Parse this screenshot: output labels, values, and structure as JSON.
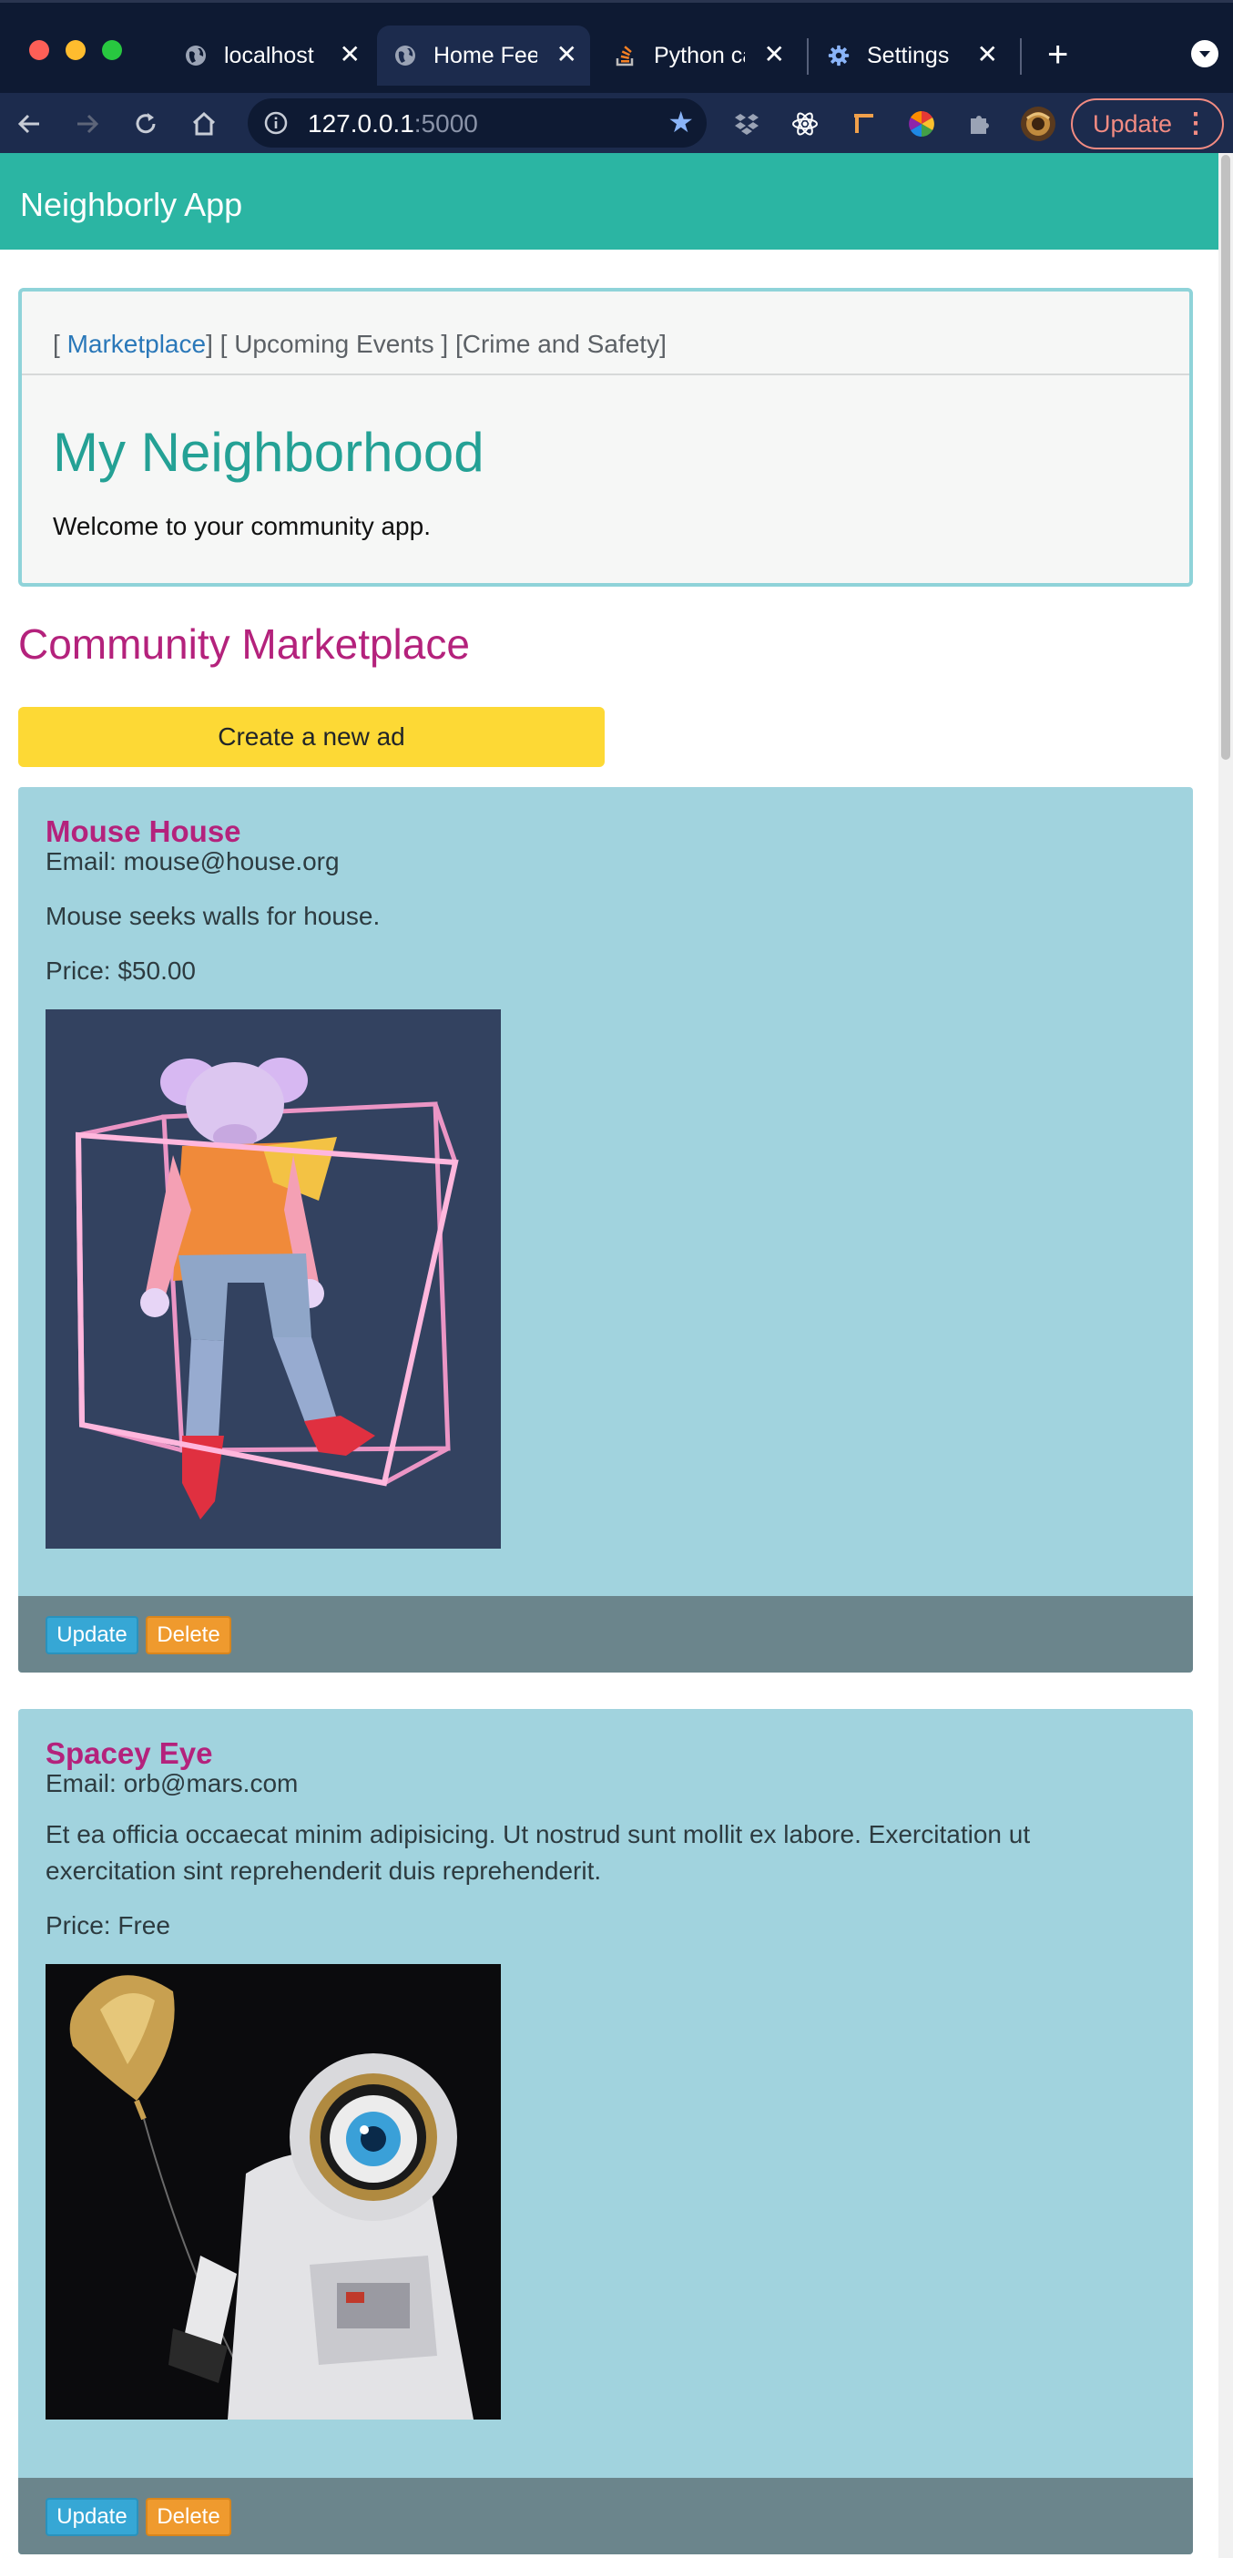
{
  "browser": {
    "tabs": [
      {
        "title": "localhost",
        "icon": "globe-icon",
        "active": false
      },
      {
        "title": "Home Feed",
        "icon": "globe-icon",
        "active": true
      },
      {
        "title": "Python ca",
        "icon": "stackoverflow-icon",
        "active": false
      },
      {
        "title": "Settings",
        "icon": "gear-icon",
        "active": false
      }
    ],
    "url_host": "127.0.0.1",
    "url_port": ":5000",
    "update_label": "Update",
    "extensions": [
      "dropbox-icon",
      "react-icon",
      "ruler-icon",
      "color-wheel-icon",
      "puzzle-icon",
      "profile-avatar"
    ]
  },
  "app": {
    "brand": "Neighborly App"
  },
  "jumbotron": {
    "link_prefix": "[ ",
    "link_marketplace": "Marketplace",
    "link_rest": "] [ Upcoming Events ] [Crime and Safety]",
    "heading": "My Neighborhood",
    "welcome": "Welcome to your community app."
  },
  "marketplace": {
    "title": "Community Marketplace",
    "create_label": "Create a new ad",
    "update_label": "Update",
    "delete_label": "Delete",
    "ads": [
      {
        "title": "Mouse House",
        "email": "Email: mouse@house.org",
        "description": "Mouse seeks walls for house.",
        "price": "Price: $50.00"
      },
      {
        "title": "Spacey Eye",
        "email": "Email: orb@mars.com",
        "description": "Et ea officia occaecat minim adipisicing. Ut nostrud sunt mollit ex labore. Exercitation ut exercitation sint reprehenderit duis reprehenderit.",
        "price": "Price: Free"
      }
    ]
  }
}
